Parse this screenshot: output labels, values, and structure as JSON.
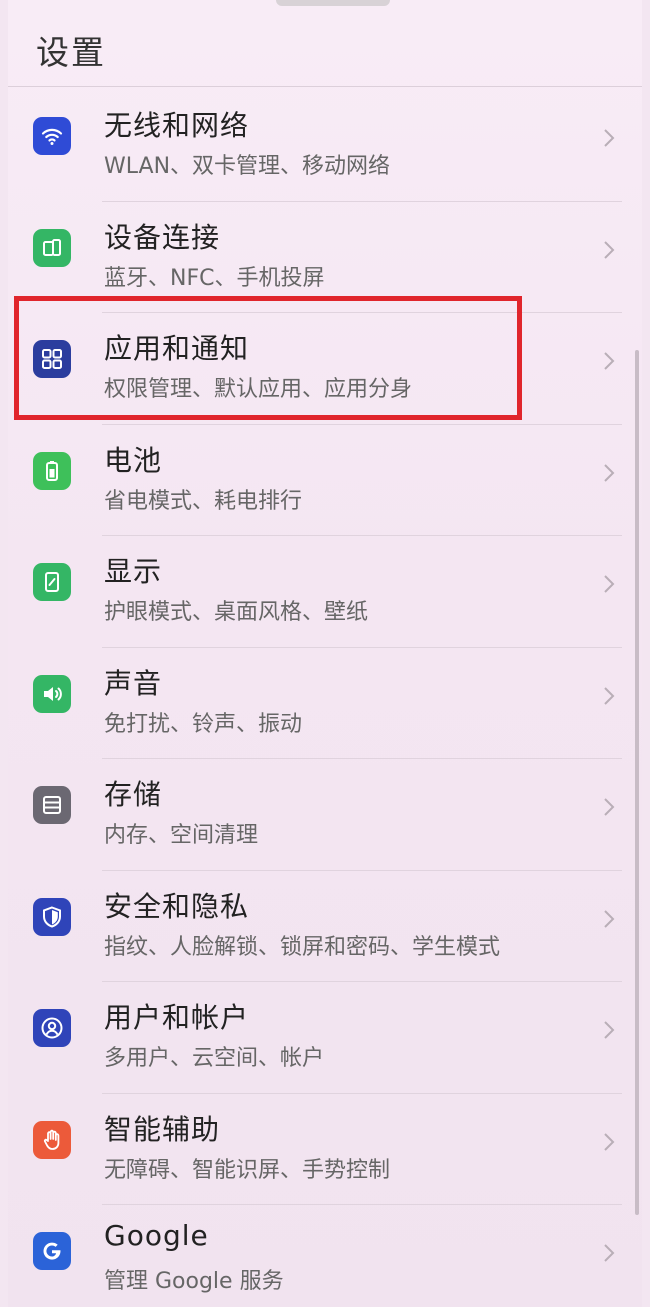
{
  "header": {
    "title": "设置"
  },
  "items": [
    {
      "title": "无线和网络",
      "subtitle": "WLAN、双卡管理、移动网络",
      "icon": "wifi-icon",
      "color": "#2f4bd6"
    },
    {
      "title": "设备连接",
      "subtitle": "蓝牙、NFC、手机投屏",
      "icon": "device-connection-icon",
      "color": "#34b665"
    },
    {
      "title": "应用和通知",
      "subtitle": "权限管理、默认应用、应用分身",
      "icon": "apps-grid-icon",
      "color": "#2b3d9e"
    },
    {
      "title": "电池",
      "subtitle": "省电模式、耗电排行",
      "icon": "battery-icon",
      "color": "#3ec05a"
    },
    {
      "title": "显示",
      "subtitle": "护眼模式、桌面风格、壁纸",
      "icon": "display-icon",
      "color": "#34b665"
    },
    {
      "title": "声音",
      "subtitle": "免打扰、铃声、振动",
      "icon": "speaker-icon",
      "color": "#34b665"
    },
    {
      "title": "存储",
      "subtitle": "内存、空间清理",
      "icon": "storage-icon",
      "color": "#6b6872"
    },
    {
      "title": "安全和隐私",
      "subtitle": "指纹、人脸解锁、锁屏和密码、学生模式",
      "icon": "shield-icon",
      "color": "#2f44b9"
    },
    {
      "title": "用户和帐户",
      "subtitle": "多用户、云空间、帐户",
      "icon": "user-icon",
      "color": "#2f44b9"
    },
    {
      "title": "智能辅助",
      "subtitle": "无障碍、智能识屏、手势控制",
      "icon": "hand-icon",
      "color": "#ec5a3a"
    },
    {
      "title": "Google",
      "subtitle": "管理 Google 服务",
      "icon": "google-icon",
      "color": "#2b63d8"
    }
  ],
  "highlight": {
    "color": "#e0252c"
  }
}
